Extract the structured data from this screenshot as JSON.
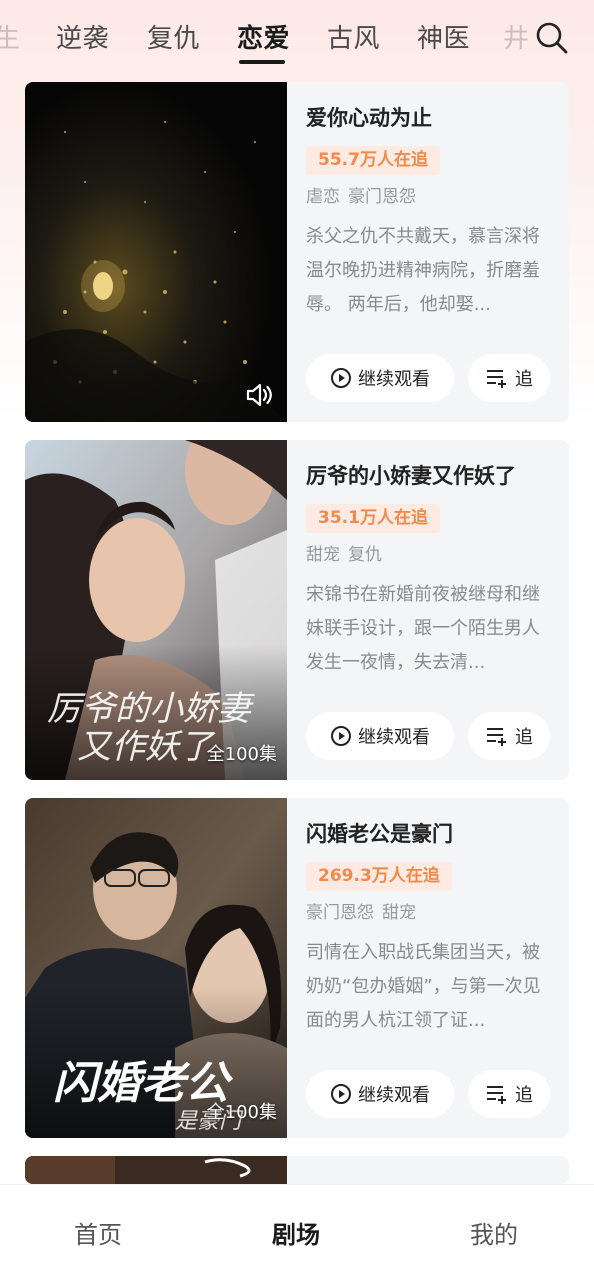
{
  "tabs": [
    {
      "label": "逆袭"
    },
    {
      "label": "复仇"
    },
    {
      "label": "恋爱",
      "active": true
    },
    {
      "label": "古风"
    },
    {
      "label": "神医"
    }
  ],
  "tabs_partial_left": "生",
  "tabs_partial_right": "井",
  "search_icon": "search-icon",
  "dramas": [
    {
      "title": "爱你心动为止",
      "followers": "55.7万人在追",
      "tags": [
        "虐恋",
        "豪门恩怨"
      ],
      "description": "杀父之仇不共戴天，慕言深将温尔晚扔进精神病院，折磨羞辱。 两年后，他却娶...",
      "watch_label": "继续观看",
      "follow_label": "追",
      "poster_overlay": ""
    },
    {
      "title": "厉爷的小娇妻又作妖了",
      "followers": "35.1万人在追",
      "tags": [
        "甜宠",
        "复仇"
      ],
      "description": "宋锦书在新婚前夜被继母和继妹联手设计，跟一个陌生男人发生一夜情，失去清...",
      "watch_label": "继续观看",
      "follow_label": "追",
      "poster_overlay": "全100集"
    },
    {
      "title": "闪婚老公是豪门",
      "followers": "269.3万人在追",
      "tags": [
        "豪门恩怨",
        "甜宠"
      ],
      "description": "司情在入职战氏集团当天，被奶奶“包办婚姻”，与第一次见面的男人杭江领了证...",
      "watch_label": "继续观看",
      "follow_label": "追",
      "poster_overlay": "全100集"
    }
  ],
  "bottom_nav": [
    {
      "label": "首页"
    },
    {
      "label": "剧场",
      "active": true
    },
    {
      "label": "我的"
    }
  ],
  "colors": {
    "badge_bg": "#fdebe3",
    "badge_text": "#ef8a4a",
    "card_bg": "#f4f5f7"
  }
}
